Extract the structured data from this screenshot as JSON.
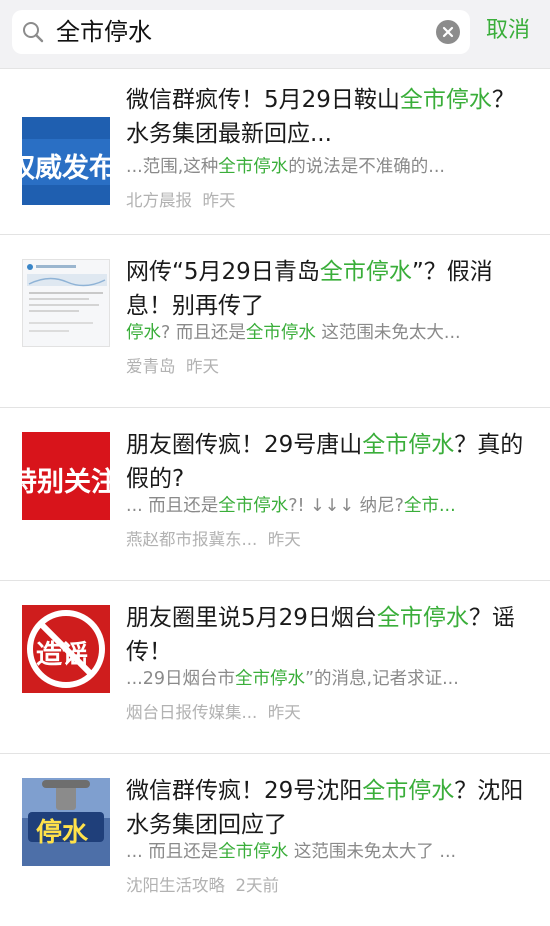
{
  "search": {
    "query": "全市停水",
    "cancel_label": "取消"
  },
  "results": [
    {
      "title_parts": [
        "微信群疯传！5月29日鞍山",
        "全市停水",
        "？水务集团最新回应..."
      ],
      "snippet_parts": [
        "...范围,这种",
        "全市停水",
        "的说法是不准确的..."
      ],
      "source": "北方晨报",
      "time": "昨天",
      "thumb_text": "权威发布"
    },
    {
      "title_parts": [
        "网传“5月29日青岛",
        "全市停水",
        "”？假消息！别再传了"
      ],
      "snippet_parts": [
        "停水",
        "? 而且还是",
        "全市停水",
        " 这范围未免太大..."
      ],
      "source": "爱青岛",
      "time": "昨天",
      "thumb_text": ""
    },
    {
      "title_parts": [
        "朋友圈传疯！29号唐山",
        "全市停水",
        "？真的假的?"
      ],
      "snippet_parts": [
        "... 而且还是",
        "全市停水",
        "?! ↓↓↓ 纳尼?",
        "全市..."
      ],
      "source": "燕赵都市报冀东...",
      "time": "昨天",
      "thumb_text": "特别关注"
    },
    {
      "title_parts": [
        "朋友圈里说5月29日烟台",
        "全市停水",
        "？谣传！"
      ],
      "snippet_parts": [
        "...29日烟台市",
        "全市停水",
        "”的消息,记者求证..."
      ],
      "source": "烟台日报传媒集...",
      "time": "昨天",
      "thumb_text": "造谣"
    },
    {
      "title_parts": [
        "微信群传疯！29号沈阳",
        "全市停水",
        "？沈阳水务集团回应了"
      ],
      "snippet_parts": [
        "... 而且还是",
        "全市停水",
        " 这范围未免太大了 ..."
      ],
      "source": "沈阳生活攻略",
      "time": "2天前",
      "thumb_text": "停水"
    }
  ],
  "colors": {
    "highlight": "#3aae3a",
    "source": "#b2b2b2",
    "snippet": "#8a8a8a"
  }
}
